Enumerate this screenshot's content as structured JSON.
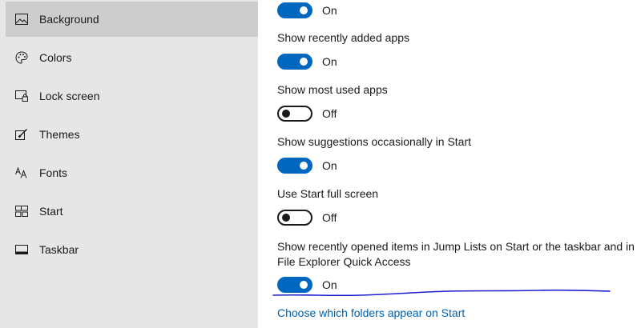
{
  "sidebar": {
    "items": [
      {
        "label": "Background",
        "icon": "image-icon"
      },
      {
        "label": "Colors",
        "icon": "palette-icon"
      },
      {
        "label": "Lock screen",
        "icon": "lock-screen-icon"
      },
      {
        "label": "Themes",
        "icon": "brush-icon"
      },
      {
        "label": "Fonts",
        "icon": "font-icon"
      },
      {
        "label": "Start",
        "icon": "start-icon"
      },
      {
        "label": "Taskbar",
        "icon": "taskbar-icon"
      }
    ],
    "selected": "Background"
  },
  "settings": {
    "top_toggle": {
      "state_label": "On"
    },
    "items": [
      {
        "label": "Show recently added apps",
        "state_label": "On",
        "on": true
      },
      {
        "label": "Show most used apps",
        "state_label": "Off",
        "on": false
      },
      {
        "label": "Show suggestions occasionally in Start",
        "state_label": "On",
        "on": true
      },
      {
        "label": "Use Start full screen",
        "state_label": "Off",
        "on": false
      },
      {
        "label": "Show recently opened items in Jump Lists on Start or the taskbar and in File Explorer Quick Access",
        "state_label": "On",
        "on": true
      }
    ],
    "link": "Choose which folders appear on Start"
  },
  "colors": {
    "accent": "#0067c0",
    "link": "#0063b1",
    "sidebar_bg": "#e6e6e6",
    "selected_bg": "#cdcdcd",
    "annotation": "#1f1fd1"
  }
}
